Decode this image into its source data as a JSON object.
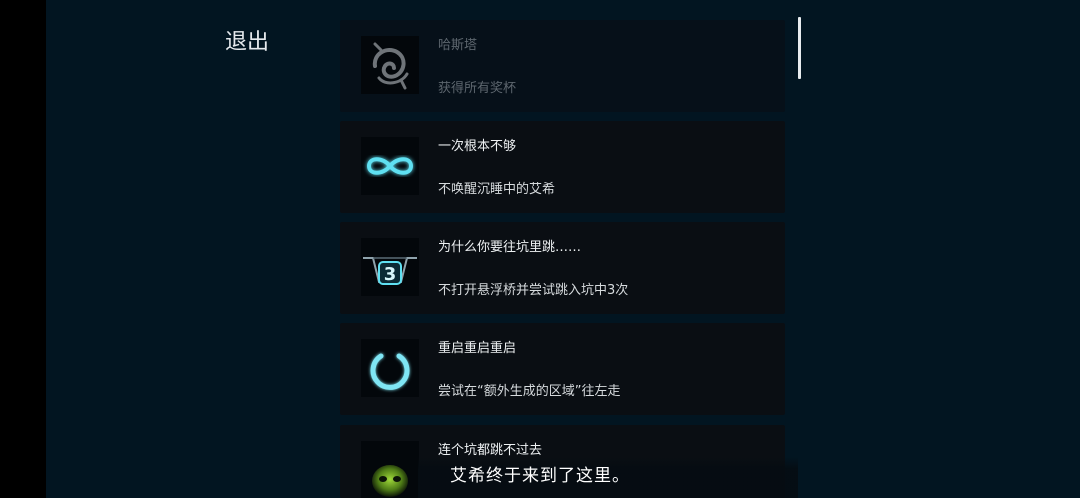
{
  "header": {
    "exit_label": "退出"
  },
  "achievements": [
    {
      "icon": "spiral-rune-icon",
      "title": "哈斯塔",
      "description": "获得所有奖杯",
      "locked": true
    },
    {
      "icon": "infinity-icon",
      "title": "一次根本不够",
      "description": "不唤醒沉睡中的艾希",
      "locked": false
    },
    {
      "icon": "pit-three-icon",
      "title": "为什么你要往坑里跳……",
      "description": "不打开悬浮桥并尝试跳入坑中3次",
      "locked": false,
      "badge": "3"
    },
    {
      "icon": "power-icon",
      "title": "重启重启重启",
      "description": "尝试在“额外生成的区域”往左走",
      "locked": false
    },
    {
      "icon": "green-skull-icon",
      "title": "连个坑都跳不过去",
      "description": "",
      "locked": false
    }
  ],
  "subtitle": "艾希终于来到了这里。",
  "colors": {
    "background": "#021521",
    "card": "#0a0e13",
    "accent_cyan": "#5fe0f2",
    "skull_green": "#7bbf2e"
  }
}
